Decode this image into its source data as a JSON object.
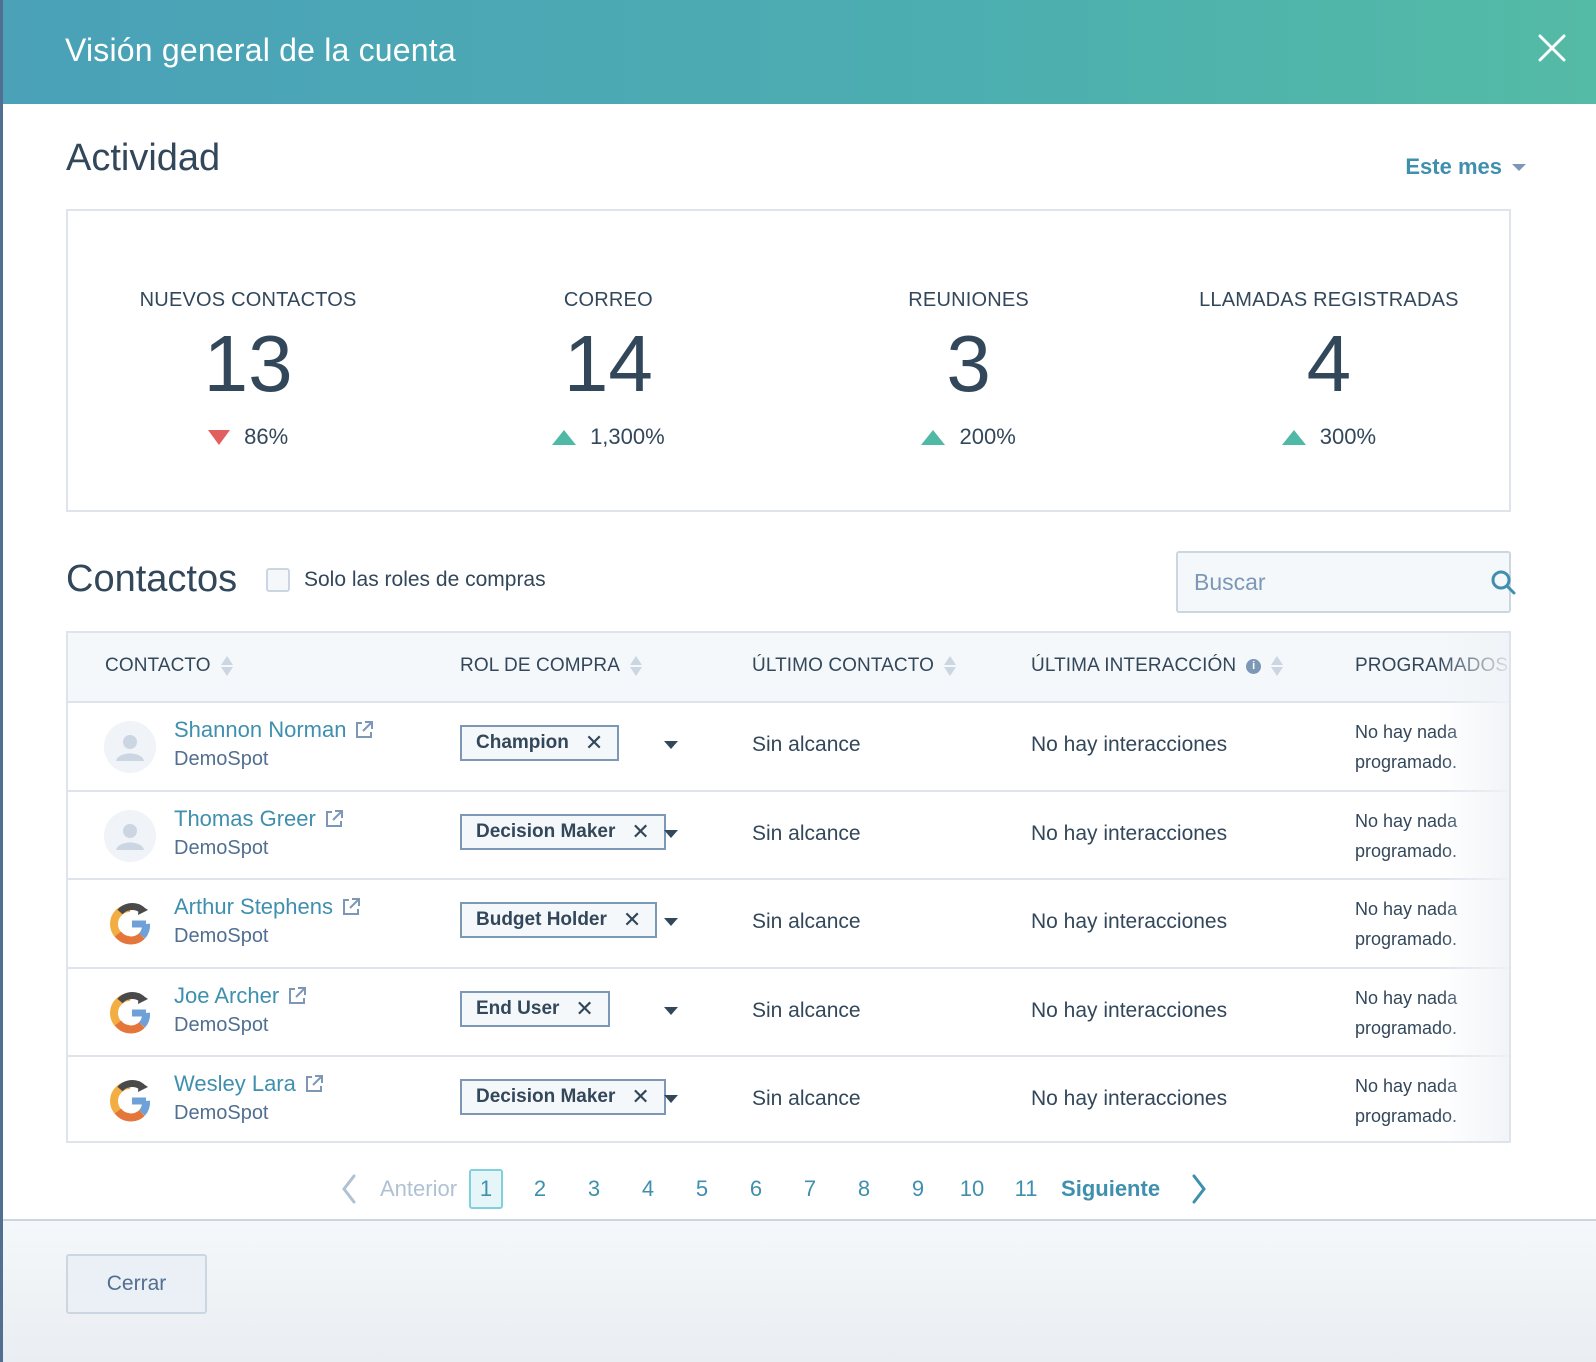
{
  "modal": {
    "title": "Visión general de la cuenta",
    "close_icon": "close-icon"
  },
  "activity": {
    "title": "Actividad",
    "period_label": "Este mes",
    "stats": [
      {
        "label": "NUEVOS CONTACTOS",
        "value": "13",
        "change": "86%",
        "direction": "down"
      },
      {
        "label": "CORREO",
        "value": "14",
        "change": "1,300%",
        "direction": "up"
      },
      {
        "label": "REUNIONES",
        "value": "3",
        "change": "200%",
        "direction": "up"
      },
      {
        "label": "LLAMADAS REGISTRADAS",
        "value": "4",
        "change": "300%",
        "direction": "up"
      }
    ]
  },
  "contacts": {
    "title": "Contactos",
    "filter_label": "Solo las roles de compras",
    "filter_checked": false,
    "search_placeholder": "Buscar",
    "search_value": "",
    "columns": [
      "CONTACTO",
      "ROL DE COMPRA",
      "ÚLTIMO CONTACTO",
      "ÚLTIMA INTERACCIÓN",
      "PROGRAMADOS"
    ],
    "rows": [
      {
        "name": "Shannon Norman",
        "company": "DemoSpot",
        "avatar": "person-placeholder",
        "role": "Champion",
        "last_contact": "Sin alcance",
        "last_interaction": "No hay interacciones",
        "scheduled": "No hay nada programado."
      },
      {
        "name": "Thomas Greer",
        "company": "DemoSpot",
        "avatar": "person-placeholder",
        "role": "Decision Maker",
        "last_contact": "Sin alcance",
        "last_interaction": "No hay interacciones",
        "scheduled": "No hay nada programado."
      },
      {
        "name": "Arthur Stephens",
        "company": "DemoSpot",
        "avatar": "company-logo",
        "role": "Budget Holder",
        "last_contact": "Sin alcance",
        "last_interaction": "No hay interacciones",
        "scheduled": "No hay nada programado."
      },
      {
        "name": "Joe Archer",
        "company": "DemoSpot",
        "avatar": "company-logo",
        "role": "End User",
        "last_contact": "Sin alcance",
        "last_interaction": "No hay interacciones",
        "scheduled": "No hay nada programado."
      },
      {
        "name": "Wesley Lara",
        "company": "DemoSpot",
        "avatar": "company-logo",
        "role": "Decision Maker",
        "last_contact": "Sin alcance",
        "last_interaction": "No hay interacciones",
        "scheduled": "No hay nada programado."
      }
    ]
  },
  "pagination": {
    "prev_label": "Anterior",
    "next_label": "Siguiente",
    "pages": [
      "1",
      "2",
      "3",
      "4",
      "5",
      "6",
      "7",
      "8",
      "9",
      "10",
      "11"
    ],
    "current_page": "1"
  },
  "footer": {
    "close_label": "Cerrar"
  },
  "colors": {
    "header_gradient_start": "#4aa1b8",
    "header_gradient_end": "#54bba6",
    "link": "#3f8fae",
    "up": "#4fb9a5",
    "down": "#e25f5f",
    "text": "#33475b"
  }
}
